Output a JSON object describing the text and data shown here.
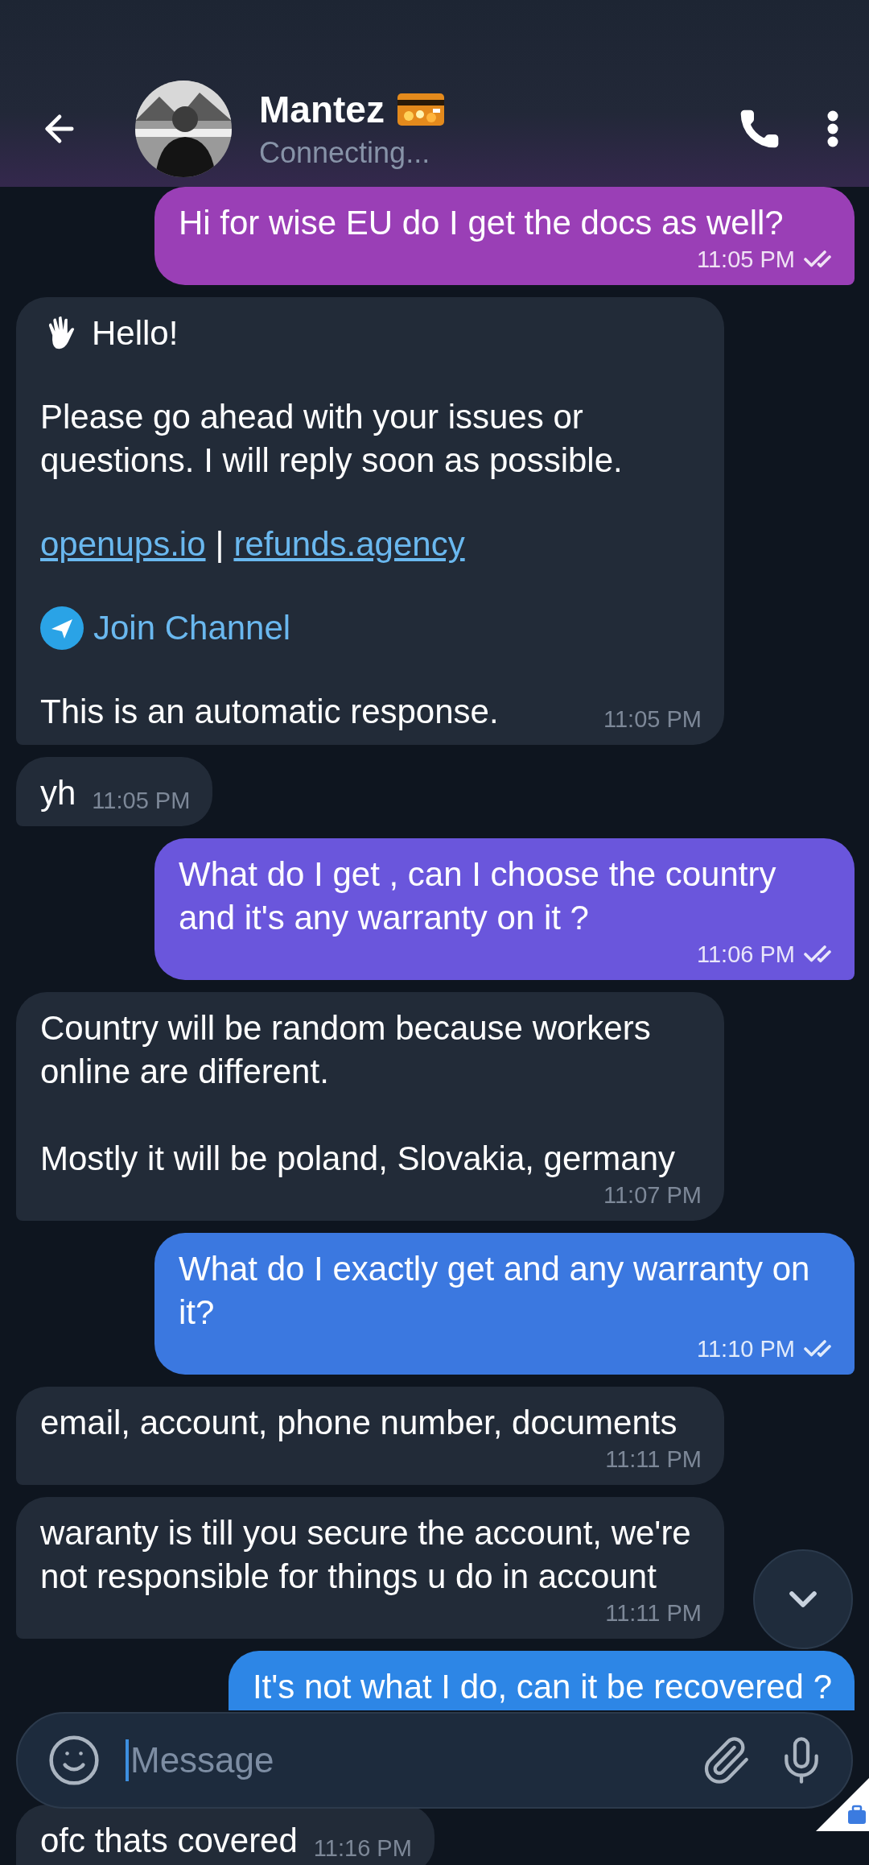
{
  "header": {
    "name": "Mantez",
    "status": "Connecting..."
  },
  "messages": [
    {
      "kind": "text",
      "outgoing": true,
      "color": "#9a3fb6",
      "text": "Hi for wise EU do I get the docs as well?",
      "time": "11:05 PM",
      "read": true
    },
    {
      "kind": "welcome",
      "outgoing": false,
      "greeting": "Hello!",
      "body": "Please go ahead with your issues or questions. I will reply soon as possible.",
      "links": [
        "openups.io",
        "refunds.agency"
      ],
      "separator": "|",
      "channel": "Join Channel",
      "footer": "This is an automatic response.",
      "time": "11:05 PM"
    },
    {
      "kind": "text",
      "outgoing": false,
      "text": "yh",
      "time": "11:05 PM"
    },
    {
      "kind": "text",
      "outgoing": true,
      "color": "#6a56dc",
      "text": "What do I get , can I choose the country and it's any warranty on it ?",
      "time": "11:06 PM",
      "read": true
    },
    {
      "kind": "text",
      "outgoing": false,
      "text": "Country will be random because workers online are different.\n\nMostly it will be poland, Slovakia, germany",
      "time": "11:07 PM"
    },
    {
      "kind": "text",
      "outgoing": true,
      "color": "#3b78e0",
      "text": "What do I exactly get and any warranty on it?",
      "time": "11:10 PM",
      "read": true
    },
    {
      "kind": "text",
      "outgoing": false,
      "text": "email, account, phone number, documents",
      "time": "11:11 PM"
    },
    {
      "kind": "text",
      "outgoing": false,
      "text": "waranty is till you secure the account, we're not responsible for things u do in account",
      "time": "11:11 PM"
    },
    {
      "kind": "text",
      "outgoing": true,
      "color": "#2d86e6",
      "text": "It's not what I do, can it be recovered ?"
    },
    {
      "kind": "text",
      "outgoing": false,
      "text": "ofc thats covered",
      "time": "11:16 PM"
    }
  ],
  "composer": {
    "placeholder": "Message"
  }
}
